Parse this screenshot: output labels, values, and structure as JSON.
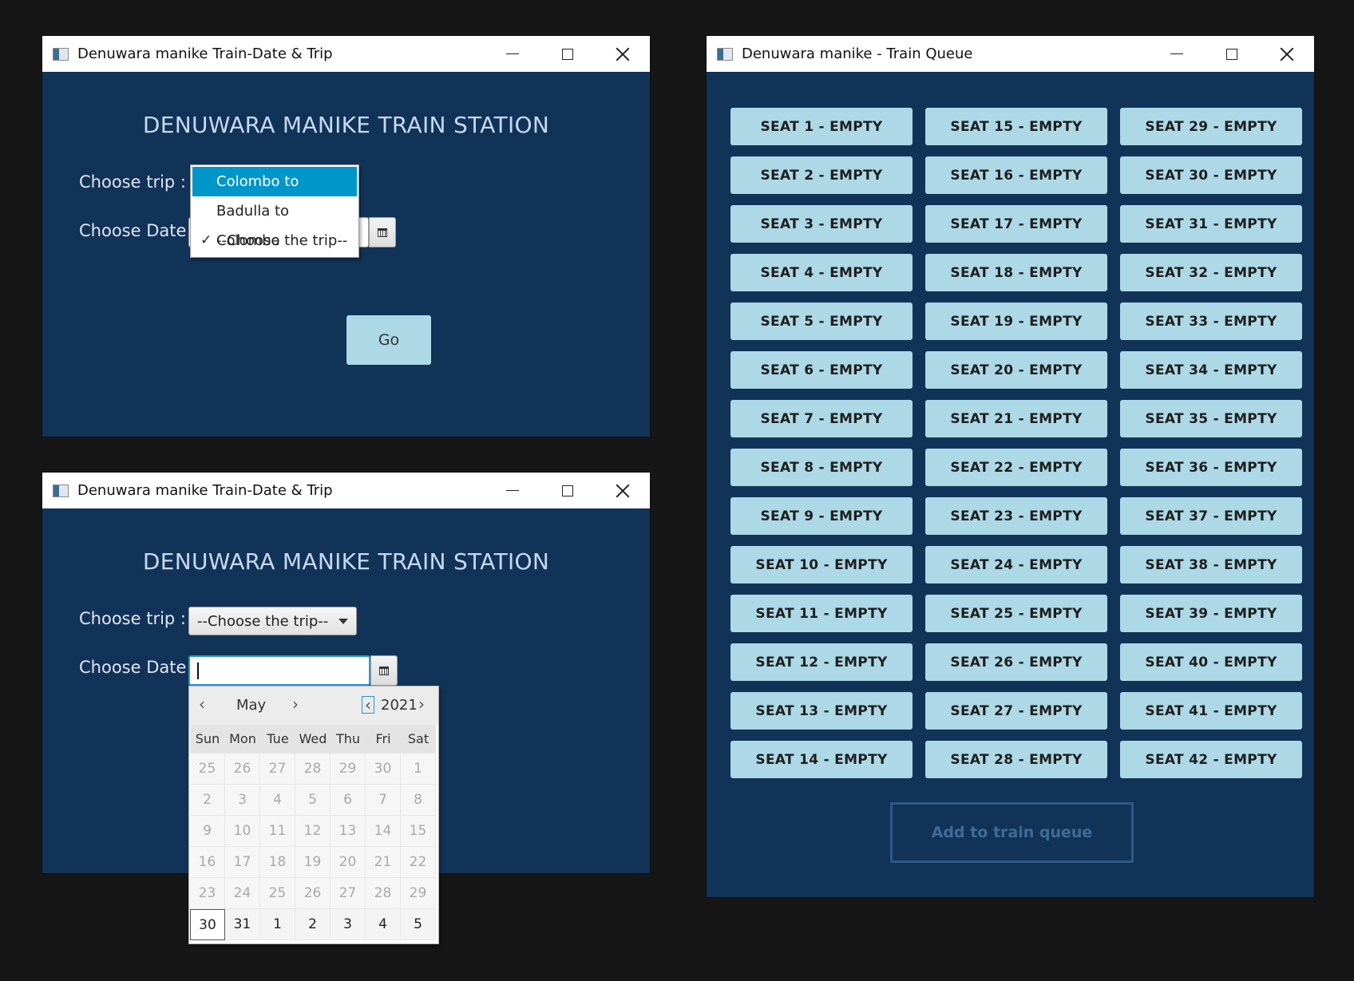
{
  "window1": {
    "title": "Denuwara manike Train-Date & Trip",
    "heading": "DENUWARA MANIKE TRAIN STATION",
    "trip_label": "Choose trip :",
    "date_label": "Choose Date :",
    "dropdown_options": [
      {
        "label": "Colombo to Badulla",
        "highlighted": true,
        "checked": false
      },
      {
        "label": "Badulla to Colombo",
        "highlighted": false,
        "checked": false
      },
      {
        "label": "--Choose the trip--",
        "highlighted": false,
        "checked": true
      }
    ],
    "checkmark": "✓",
    "go_label": "Go"
  },
  "window2": {
    "title": "Denuwara manike Train-Date & Trip",
    "heading": "DENUWARA MANIKE TRAIN STATION",
    "trip_label": "Choose trip :",
    "trip_value": "--Choose the trip--",
    "date_label": "Choose Date :",
    "date_value": "",
    "calendar": {
      "month": "May",
      "year": "2021",
      "prev_month": "‹",
      "next_month": "›",
      "prev_year": "‹",
      "next_year": "›",
      "weekdays": [
        "Sun",
        "Mon",
        "Tue",
        "Wed",
        "Thu",
        "Fri",
        "Sat"
      ],
      "days": [
        "25",
        "26",
        "27",
        "28",
        "29",
        "30",
        "1",
        "2",
        "3",
        "4",
        "5",
        "6",
        "7",
        "8",
        "9",
        "10",
        "11",
        "12",
        "13",
        "14",
        "15",
        "16",
        "17",
        "18",
        "19",
        "20",
        "21",
        "22",
        "23",
        "24",
        "25",
        "26",
        "27",
        "28",
        "29",
        "30",
        "31",
        "1",
        "2",
        "3",
        "4",
        "5"
      ],
      "today_index": 35
    }
  },
  "window3": {
    "title": "Denuwara manike - Train Queue",
    "seats": [
      "SEAT 1 - EMPTY",
      "SEAT 2 - EMPTY",
      "SEAT 3 - EMPTY",
      "SEAT 4 - EMPTY",
      "SEAT 5 - EMPTY",
      "SEAT 6 - EMPTY",
      "SEAT 7 - EMPTY",
      "SEAT 8 - EMPTY",
      "SEAT 9 - EMPTY",
      "SEAT 10 - EMPTY",
      "SEAT 11 - EMPTY",
      "SEAT 12 - EMPTY",
      "SEAT 13 - EMPTY",
      "SEAT 14 - EMPTY",
      "SEAT 15 - EMPTY",
      "SEAT 16 - EMPTY",
      "SEAT 17 - EMPTY",
      "SEAT 18 - EMPTY",
      "SEAT 19 - EMPTY",
      "SEAT 20 - EMPTY",
      "SEAT 21 - EMPTY",
      "SEAT 22 - EMPTY",
      "SEAT 23 - EMPTY",
      "SEAT 24 - EMPTY",
      "SEAT 25 - EMPTY",
      "SEAT 26 - EMPTY",
      "SEAT 27 - EMPTY",
      "SEAT 28 - EMPTY",
      "SEAT 29 - EMPTY",
      "SEAT 30 - EMPTY",
      "SEAT 31 - EMPTY",
      "SEAT 32 - EMPTY",
      "SEAT 33 - EMPTY",
      "SEAT 34 - EMPTY",
      "SEAT 35 - EMPTY",
      "SEAT 36 - EMPTY",
      "SEAT 37 - EMPTY",
      "SEAT 38 - EMPTY",
      "SEAT 39 - EMPTY",
      "SEAT 40 - EMPTY",
      "SEAT 41 - EMPTY",
      "SEAT 42 - EMPTY"
    ],
    "add_label": "Add to train queue"
  },
  "colors": {
    "window_bg": "#123358",
    "button_bg": "#add8e6",
    "selection": "#0096c9"
  }
}
